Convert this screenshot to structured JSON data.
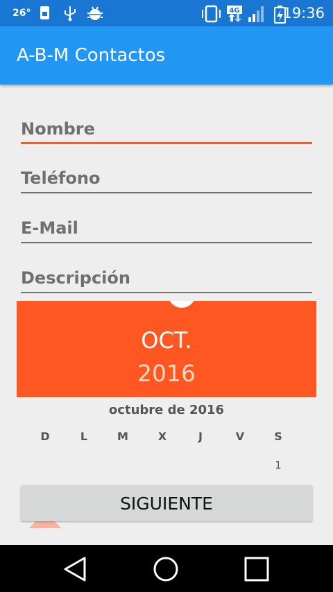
{
  "status_bar": {
    "temperature": "26°",
    "network": "4G",
    "time": "19:36"
  },
  "app_bar": {
    "title": "A-B-M Contactos"
  },
  "form": {
    "fields": [
      {
        "label": "Nombre"
      },
      {
        "label": "Teléfono"
      },
      {
        "label": "E-Mail"
      },
      {
        "label": "Descripción"
      }
    ]
  },
  "date_picker": {
    "header_month": "OCT.",
    "header_year": "2016",
    "calendar_title": "octubre de 2016",
    "weekdays": [
      "D",
      "L",
      "M",
      "X",
      "J",
      "V",
      "S"
    ],
    "first_day": "1",
    "accent_color": "#ff5722"
  },
  "buttons": {
    "next_label": "SIGUIENTE"
  },
  "nav": {
    "icons": [
      "back-icon",
      "home-icon",
      "recents-icon"
    ]
  }
}
